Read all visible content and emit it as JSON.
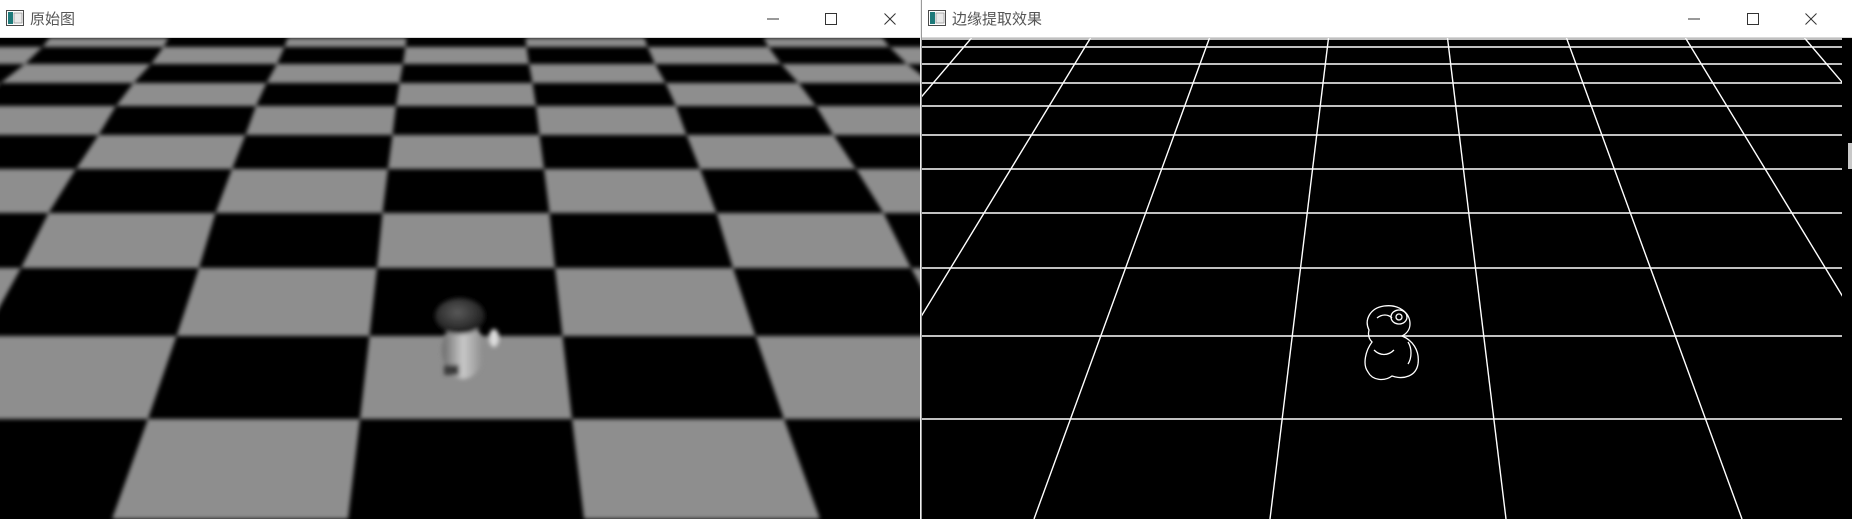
{
  "left_window": {
    "title": "原始图",
    "icon": "opencv-window-icon",
    "controls": [
      "minimize-icon",
      "maximize-icon",
      "close-icon"
    ]
  },
  "right_window": {
    "title": "边缘提取效果",
    "icon": "opencv-window-icon",
    "controls": [
      "minimize-icon",
      "maximize-icon",
      "close-icon"
    ]
  },
  "colors": {
    "gray_square": "#8e8e8e",
    "black_square": "#000000",
    "edge_line": "#ffffff",
    "title_text": "#555555"
  }
}
